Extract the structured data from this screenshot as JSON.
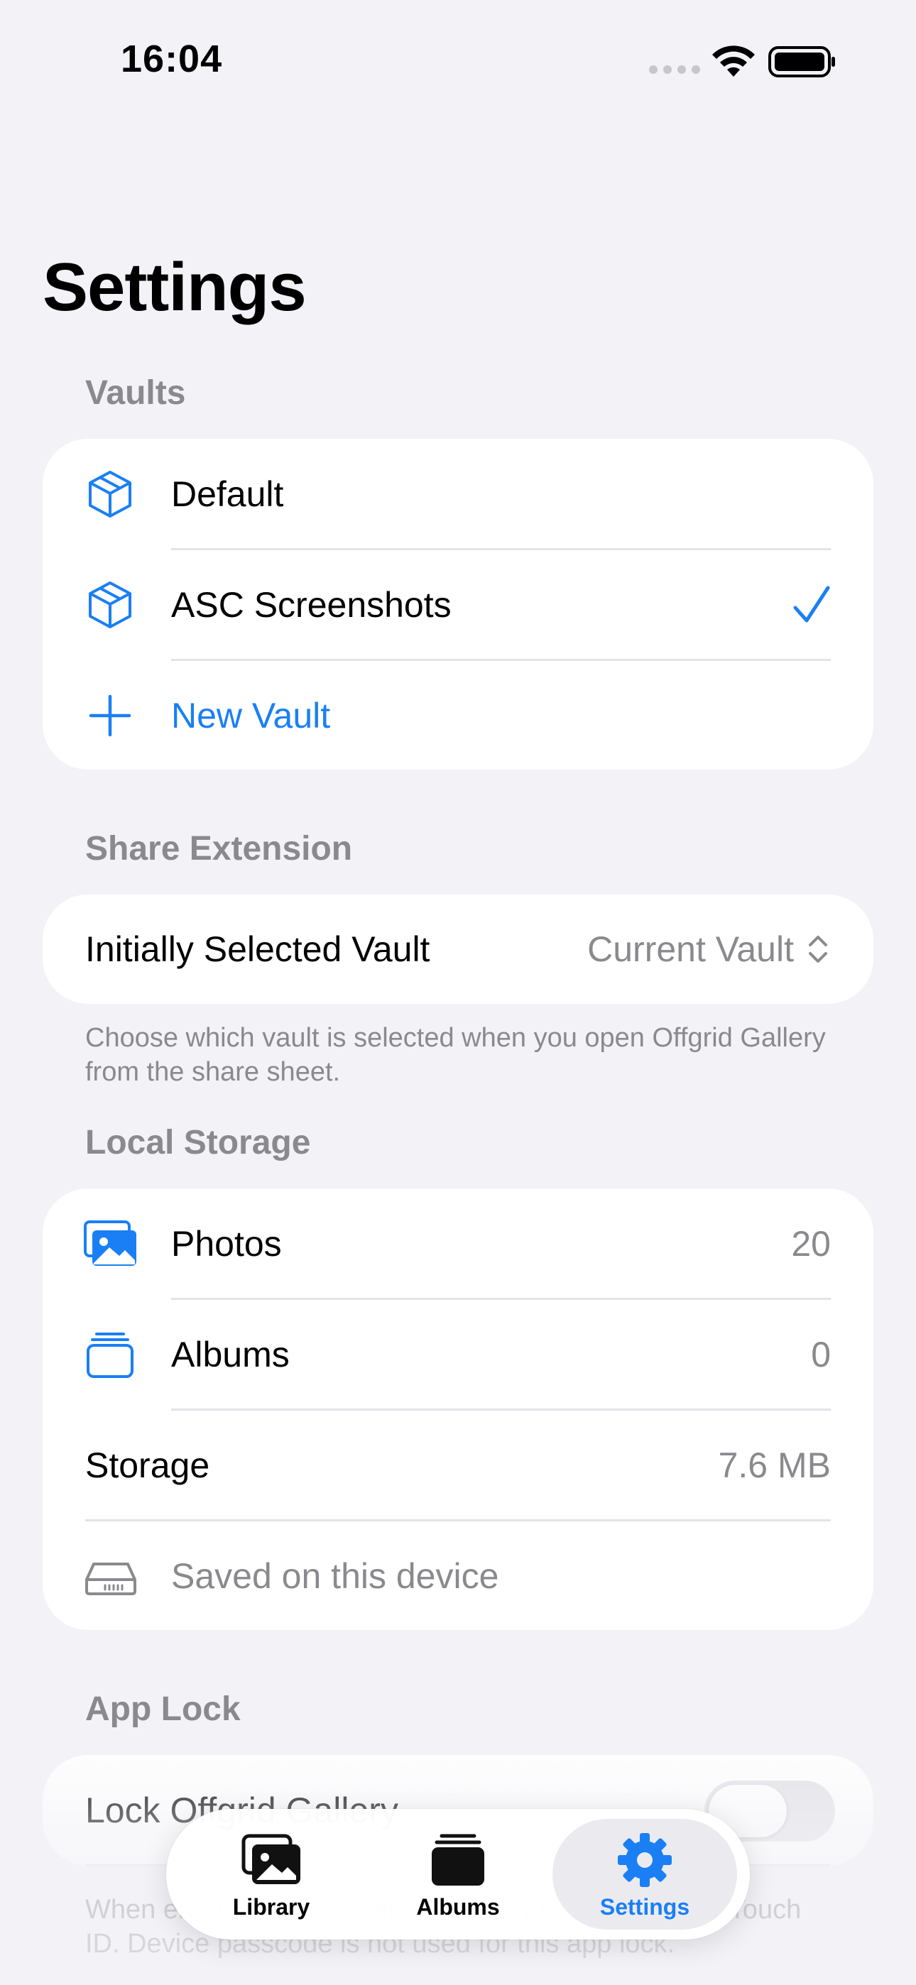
{
  "status_bar": {
    "time": "16:04"
  },
  "page": {
    "title": "Settings"
  },
  "vaults": {
    "header": "Vaults",
    "items": [
      {
        "label": "Default",
        "icon": "cube-icon",
        "selected": false
      },
      {
        "label": "ASC Screenshots",
        "icon": "cube-icon",
        "selected": true
      }
    ],
    "new_vault_label": "New Vault"
  },
  "share_extension": {
    "header": "Share Extension",
    "row_label": "Initially Selected Vault",
    "row_value": "Current Vault",
    "footnote": "Choose which vault is selected when you open Offgrid Gallery from the share sheet."
  },
  "local_storage": {
    "header": "Local Storage",
    "photos_label": "Photos",
    "photos_value": "20",
    "albums_label": "Albums",
    "albums_value": "0",
    "storage_label": "Storage",
    "storage_value": "7.6 MB",
    "location_label": "Saved on this device"
  },
  "app_lock": {
    "header": "App Lock",
    "toggle_label": "Lock Offgrid Gallery",
    "toggle_on": false,
    "footnote": "When enabled, unlock Offgrid Gallery with Face ID or Touch ID. Device passcode is not used for this app lock."
  },
  "tab_bar": {
    "tabs": [
      {
        "label": "Library",
        "icon": "photo-library-icon",
        "active": false
      },
      {
        "label": "Albums",
        "icon": "albums-stack-icon",
        "active": false
      },
      {
        "label": "Settings",
        "icon": "gear-icon",
        "active": true
      }
    ]
  },
  "colors": {
    "accent": "#1a7ff5",
    "background": "#f2f2f7",
    "secondary_text": "#8a8a8e"
  }
}
